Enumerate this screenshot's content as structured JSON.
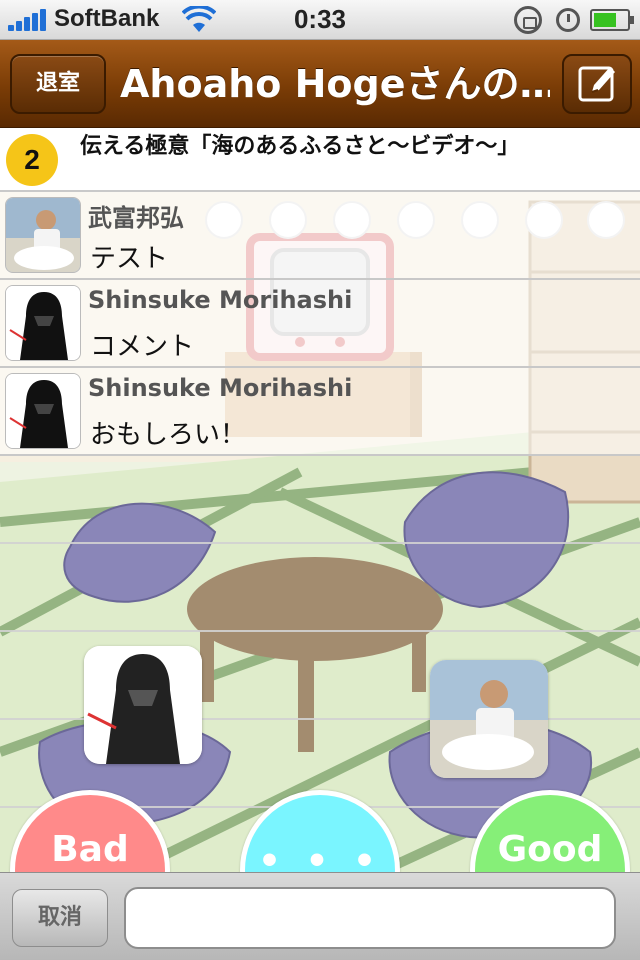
{
  "status_bar": {
    "carrier": "SoftBank",
    "time": "0:33",
    "icons": [
      "signal-icon",
      "wifi-icon",
      "rotation-lock-icon",
      "alarm-icon",
      "battery-icon"
    ]
  },
  "nav": {
    "leave_label": "退室",
    "title": "Ahoaho Hogeさんの…",
    "compose_icon": "compose-icon"
  },
  "topic": {
    "number": "2",
    "text": "伝える極意「海のあるふるさと〜ビデオ〜」"
  },
  "comments": [
    {
      "name": "武富邦弘",
      "body": "テスト",
      "avatar": "person-photo"
    },
    {
      "name": "Shinsuke Morihashi",
      "body": "コメント",
      "avatar": "darth-vader"
    },
    {
      "name": "Shinsuke Morihashi",
      "body": "おもしろい！",
      "avatar": "darth-vader"
    }
  ],
  "reactions": {
    "bad": "Bad",
    "neutral": "• • •",
    "good": "Good"
  },
  "input_bar": {
    "cancel_label": "取消",
    "input_value": ""
  },
  "colors": {
    "nav_brown": "#7a3c06",
    "badge_yellow": "#f5c518",
    "bad": "#ff8a8a",
    "neutral": "#7af5ff",
    "good": "#86ef78"
  }
}
